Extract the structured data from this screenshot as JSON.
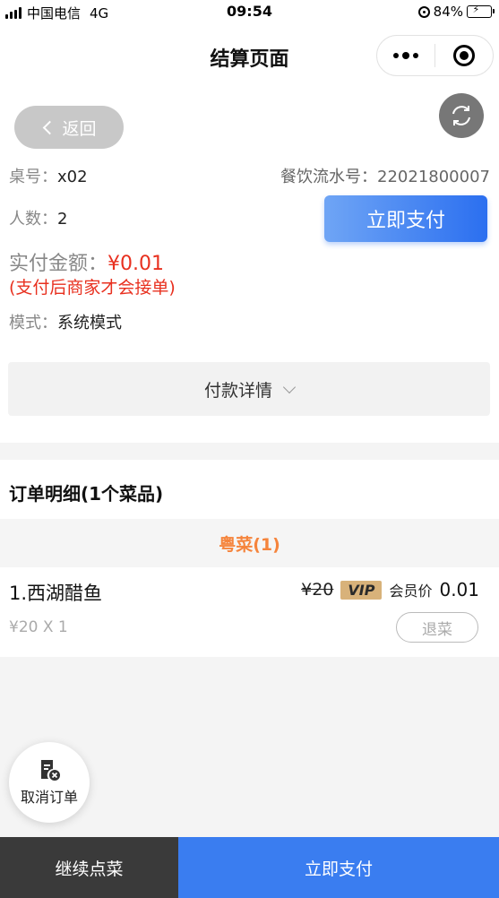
{
  "status_bar": {
    "carrier": "中国电信",
    "network": "4G",
    "time": "09:54",
    "battery": "84%",
    "icons": [
      "signal-icon",
      "orientation-lock-icon",
      "battery-charging-icon"
    ]
  },
  "nav": {
    "title": "结算页面",
    "icons": [
      "more-icon",
      "close-miniprogram-icon"
    ]
  },
  "info": {
    "back_label": "返回",
    "table_label": "桌号：",
    "table_value": "x02",
    "serial_label": "餐饮流水号：",
    "serial_value": "22021800007",
    "people_label": "人数：",
    "people_value": "2",
    "pay_now_label": "立即支付",
    "amount_label": "实付金额：",
    "amount_value": "¥0.01",
    "notice": "(支付后商家才会接单)",
    "mode_label": "模式：",
    "mode_value": "系统模式",
    "payment_detail_label": "付款详情"
  },
  "order": {
    "heading": "订单明细(1个菜品)",
    "category": "粤菜(1)",
    "items": [
      {
        "name": "1.西湖醋鱼",
        "qty_text": "¥20 X 1",
        "original_price": "¥20",
        "vip_badge": "VIP",
        "member_label": "会员价",
        "member_price": "0.01",
        "return_label": "退菜"
      }
    ]
  },
  "cancel_order_label": "取消订单",
  "bottom": {
    "continue_label": "继续点菜",
    "pay_label": "立即支付"
  },
  "colors": {
    "primary_blue": "#3a7df0",
    "price_red": "#e8301f",
    "category_orange": "#f5843c",
    "vip_gold": "#d8b27a"
  }
}
